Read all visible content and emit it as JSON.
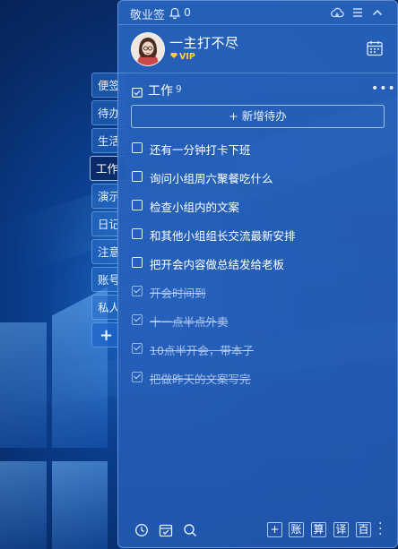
{
  "app": {
    "title": "敬业签",
    "notification_count": "0"
  },
  "user": {
    "name": "一主打不尽",
    "badge": "VIP"
  },
  "side_tabs": [
    {
      "label": "便签"
    },
    {
      "label": "待办"
    },
    {
      "label": "生活"
    },
    {
      "label": "工作"
    },
    {
      "label": "演示"
    },
    {
      "label": "日记"
    },
    {
      "label": "注意"
    },
    {
      "label": "账号"
    },
    {
      "label": "私人"
    },
    {
      "label": "+"
    }
  ],
  "category": {
    "name": "工作",
    "count": "9"
  },
  "add_todo_label": "+ 新增待办",
  "todos": [
    {
      "text": "还有一分钟打卡下班",
      "done": false
    },
    {
      "text": "询问小组周六聚餐吃什么",
      "done": false
    },
    {
      "text": "检查小组内的文案",
      "done": false
    },
    {
      "text": "和其他小组组长交流最新安排",
      "done": false
    },
    {
      "text": "把开会内容做总结发给老板",
      "done": false
    },
    {
      "text": "开会时间到",
      "done": true
    },
    {
      "text": "十一点半点外卖",
      "done": true
    },
    {
      "text": "10点半开会，带本子",
      "done": true
    },
    {
      "text": "把做昨天的文案写完",
      "done": true
    }
  ],
  "bottom_buttons": [
    "+",
    "账",
    "算",
    "译",
    "百"
  ],
  "icons": {
    "bell": "bell-icon",
    "cloud": "cloud-icon",
    "menu": "menu-icon",
    "collapse": "chevron-up-icon",
    "calendar": "calendar-icon",
    "clock": "clock-icon",
    "calendar_check": "calendar-check-icon",
    "search": "search-icon"
  },
  "colors": {
    "window_bg": "#2860bc",
    "vip_gold": "#ffd23a"
  }
}
